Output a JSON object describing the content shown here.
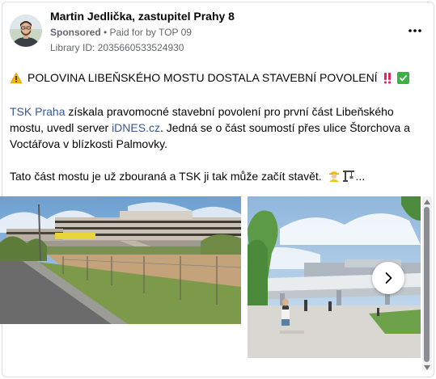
{
  "post": {
    "author": "Martin Jedlička, zastupitel Prahy 8",
    "sponsored": "Sponsored",
    "separator": " • ",
    "paid_for": "Paid for by TOP 09",
    "library_id": "Library ID: 2035660533524930",
    "more_icon": "more-horizontal-icon"
  },
  "headline": {
    "text": "POLOVINA LIBEŇSKÉHO MOSTU DOSTALA STAVEBNÍ POVOLENÍ",
    "icons": [
      "warning-icon",
      "double-exclamation-icon",
      "check-mark-icon"
    ]
  },
  "body": {
    "link1": "TSK Praha",
    "text1": " získala pravomocné stavební povolení pro první část Libeňského mostu, uvedl server ",
    "link2": "iDNES.cz",
    "text2": ". Jedná se o část soumostí přes ulice Štorchova a Voctářova v blízkosti Palmovky.",
    "text3": "Tato část mostu je už zbouraná a TSK ji tak může začít stavět.",
    "trailing_icons": [
      "construction-worker-icon",
      "construction-crane-icon"
    ],
    "ellipsis": "..."
  },
  "media": {
    "next_icon": "chevron-right-icon"
  },
  "colors": {
    "link": "#385898",
    "meta": "#65676b",
    "text": "#050505"
  }
}
